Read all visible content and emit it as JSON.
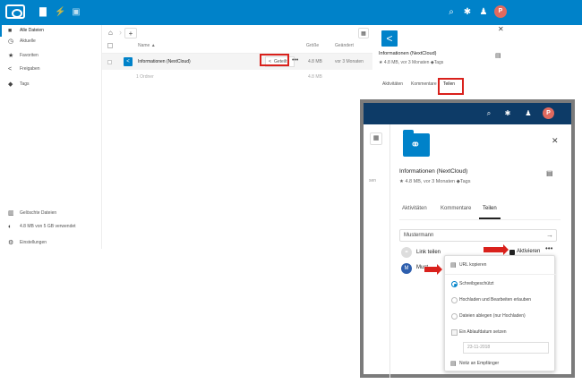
{
  "sidebar": {
    "items": [
      {
        "label": "Alle Dateien",
        "icon": "folder-icon"
      },
      {
        "label": "Aktuelle",
        "icon": "clock-icon"
      },
      {
        "label": "Favoriten",
        "icon": "star-icon"
      },
      {
        "label": "Freigaben",
        "icon": "share-icon"
      },
      {
        "label": "Tags",
        "icon": "tag-icon"
      }
    ],
    "bottom": {
      "deleted": "Gelöschte Dateien",
      "quota": "4.8 MB von 5 GB verwendet",
      "settings": "Einstellungen"
    }
  },
  "filelist": {
    "col_name": "Name ▲",
    "col_size": "Größe",
    "col_modified": "Geändert",
    "file": {
      "name": "Informationen (NextCloud)",
      "share": "Geteilt",
      "size": "4.8 MB",
      "modified": "vor 3 Monaten"
    },
    "summary": {
      "files": "1 Ordner",
      "size": "4.8 MB"
    }
  },
  "detail": {
    "title": "Informationen (NextCloud)",
    "meta": "4.8 MB, vor 3 Monaten",
    "tags": "Tags",
    "tabs": [
      "Aktivitäten",
      "Kommentare",
      "Teilen"
    ]
  },
  "inset": {
    "avatar": "P",
    "side_text": "sen",
    "title": "Informationen (NextCloud)",
    "meta": "4.8 MB, vor 3 Monaten",
    "tags": "Tags",
    "tabs": [
      "Aktivitäten",
      "Kommentare",
      "Teilen"
    ],
    "share_input": "Mustermann",
    "link_share": "Link teilen",
    "activate": "Aktivieren",
    "user_initial": "M",
    "user_name": "Must",
    "menu": {
      "copy_url": "URL kopieren",
      "readonly": "Schreibgeschützt",
      "upload_edit": "Hochladen und Bearbeiten erlauben",
      "file_drop": "Dateien ablegen (nur Hochladen)",
      "expiry": "Ein Ablaufdatum setzen",
      "date": "23-11-2018",
      "note": "Notiz an Empfänger"
    }
  },
  "user": {
    "initial": "P"
  },
  "colors": {
    "brand": "#0082c9",
    "dark_header": "#0d3b67",
    "highlight": "#d9211c"
  }
}
